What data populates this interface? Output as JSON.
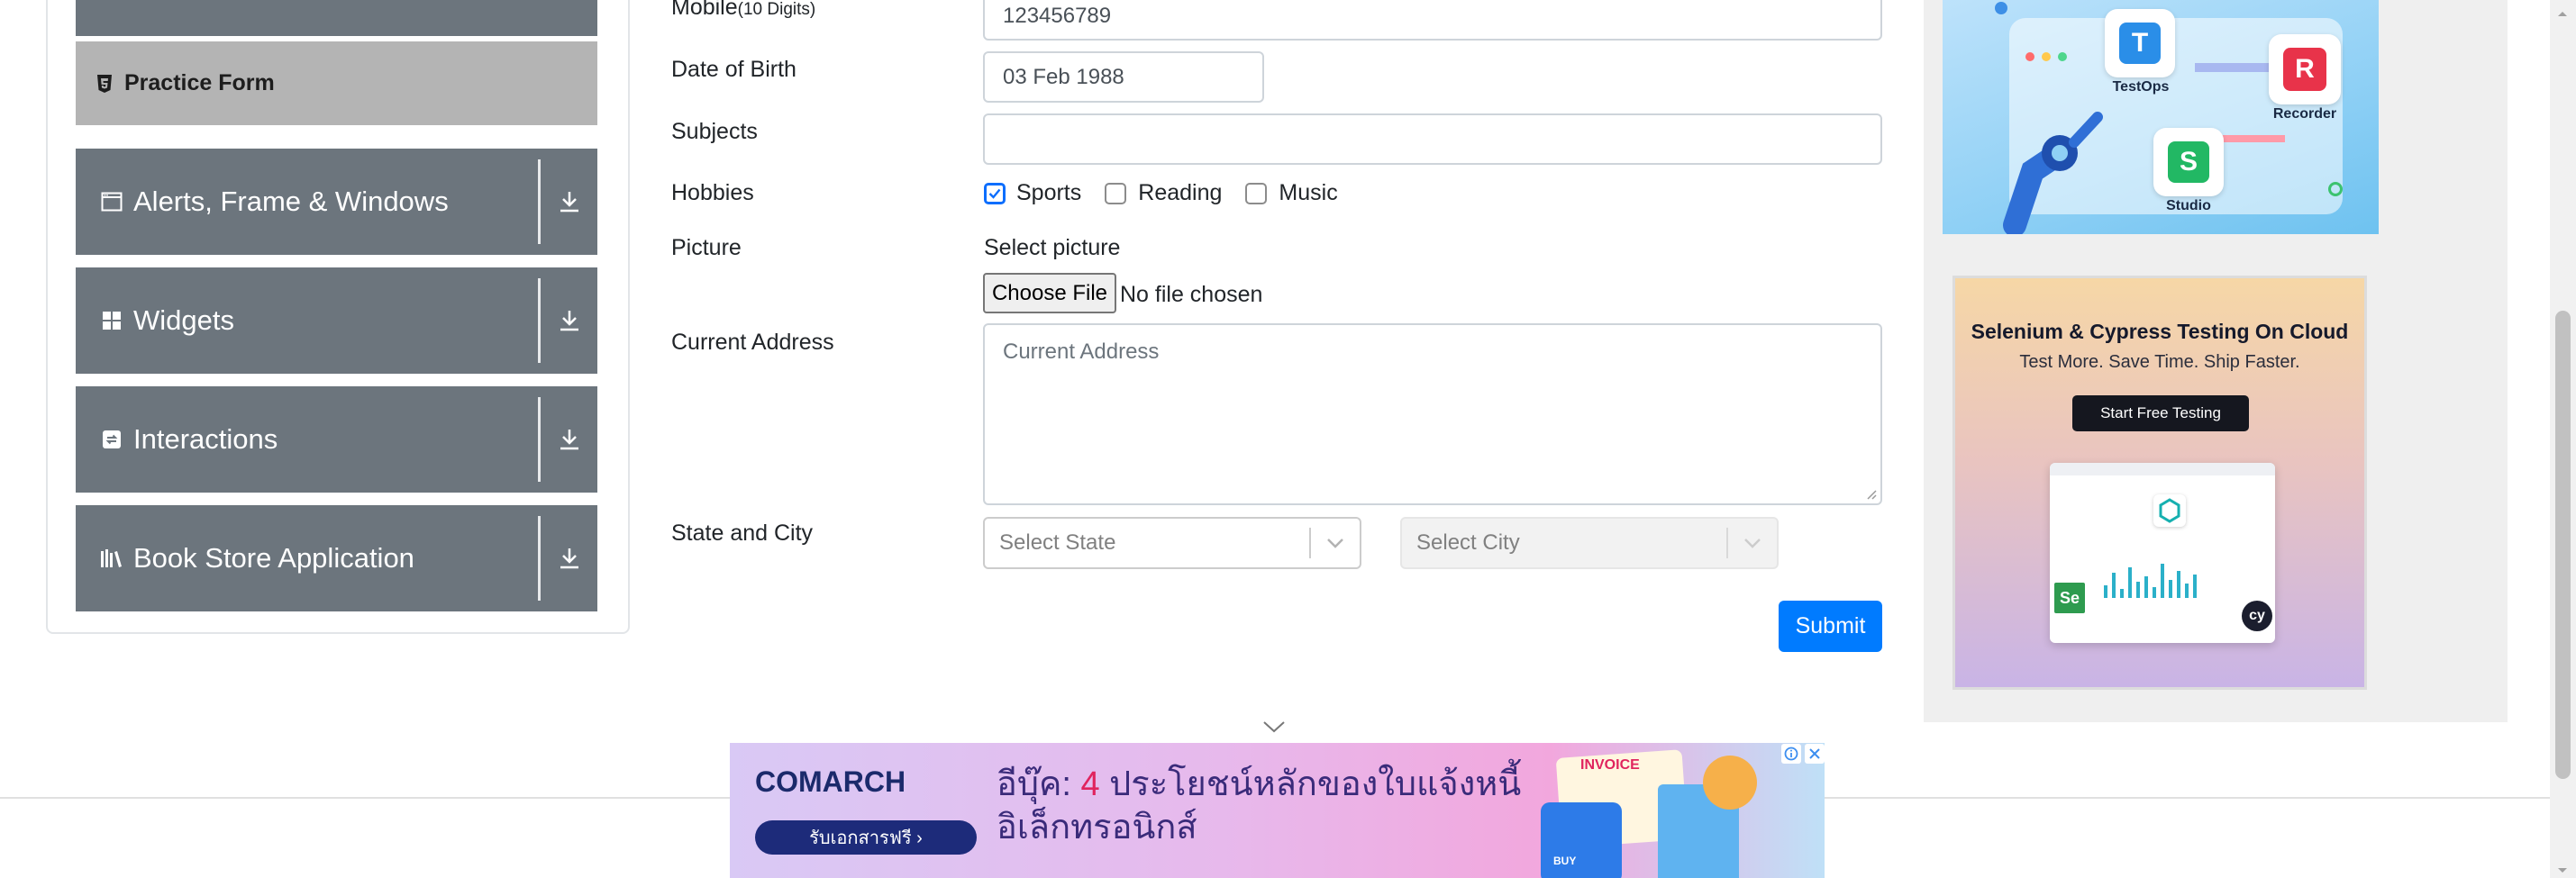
{
  "sidebar": {
    "practice_form": "Practice Form",
    "groups": [
      {
        "label": "Alerts, Frame & Windows",
        "icon": "window-icon"
      },
      {
        "label": "Widgets",
        "icon": "widgets-icon"
      },
      {
        "label": "Interactions",
        "icon": "interactions-icon"
      },
      {
        "label": "Book Store Application",
        "icon": "books-icon"
      }
    ]
  },
  "form": {
    "mobile_label": "Mobile",
    "mobile_hint": "(10 Digits)",
    "mobile_value": "123456789",
    "dob_label": "Date of Birth",
    "dob_value": "03 Feb 1988",
    "subjects_label": "Subjects",
    "subjects_value": "",
    "hobbies_label": "Hobbies",
    "hobbies": [
      {
        "label": "Sports",
        "checked": true
      },
      {
        "label": "Reading",
        "checked": false
      },
      {
        "label": "Music",
        "checked": false
      }
    ],
    "picture_label": "Picture",
    "picture_prompt": "Select picture",
    "choose_file_label": "Choose File",
    "file_status": "No file chosen",
    "address_label": "Current Address",
    "address_placeholder": "Current Address",
    "state_city_label": "State and City",
    "state_placeholder": "Select State",
    "city_placeholder": "Select City",
    "submit_label": "Submit"
  },
  "ads": {
    "top": {
      "tiles": [
        "TestOps",
        "Recorder",
        "Studio"
      ]
    },
    "bottom": {
      "title": "Selenium & Cypress Testing On Cloud",
      "subtitle": "Test More. Save Time. Ship Faster.",
      "cta": "Start Free Testing"
    },
    "banner": {
      "brand": "COMARCH",
      "cta": "รับเอกสารฟรี ›",
      "headline_prefix": "อีบุ๊ค: ",
      "headline_number": "4",
      "headline_rest": " ประโยชน์หลักของใบแจ้งหนี้อิเล็กทรอนิกส์",
      "art_label": "INVOICE",
      "buy_label": "BUY"
    }
  },
  "colors": {
    "sidebar_bg": "#6c757d",
    "active_item_bg": "#b4b4b4",
    "primary": "#007bff"
  }
}
